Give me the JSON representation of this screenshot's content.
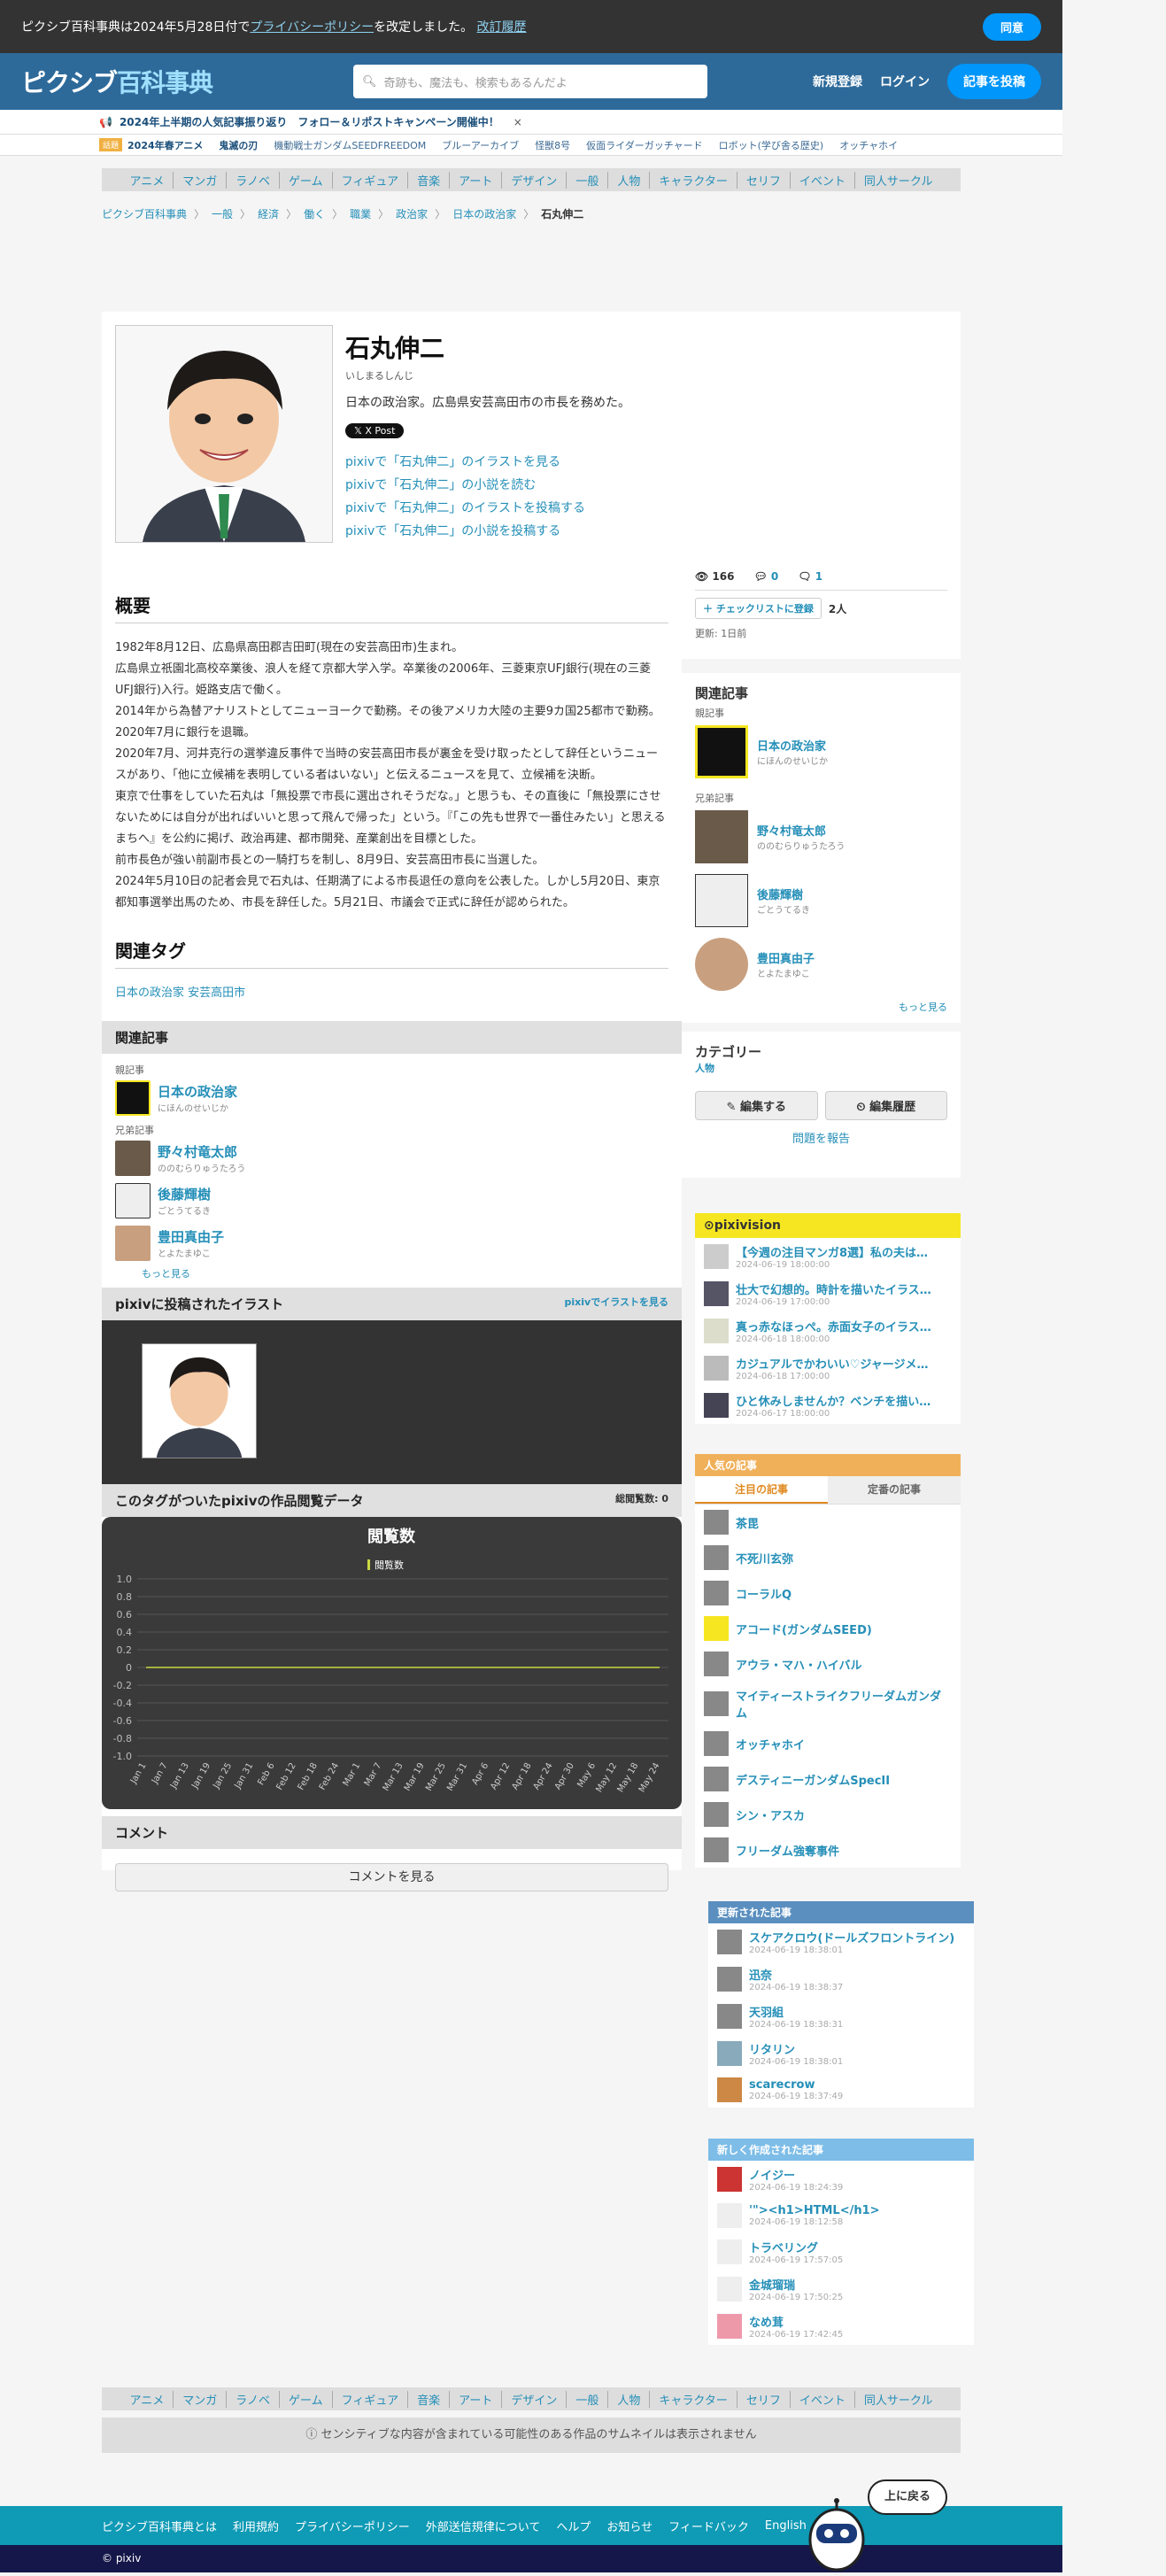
{
  "privacy": {
    "text": "ピクシブ百科事典は2024年5月28日付で",
    "link": "プライバシーポリシー",
    "text2": "を改定しました。",
    "history": "改訂履歴",
    "agree": "同意"
  },
  "header": {
    "logo_a": "ピクシブ",
    "logo_b": "百科事典",
    "search_placeholder": "奇跡も、魔法も、検索もあるんだよ",
    "register": "新規登録",
    "login": "ログイン",
    "post": "記事を投稿"
  },
  "announce": {
    "text": "2024年上半期の人気記事振り返り　フォロー＆リポストキャンペーン開催中！",
    "close": "×"
  },
  "trending": {
    "tag": "話題",
    "items": [
      "2024年春アニメ",
      "鬼滅の刃",
      "機動戦士ガンダムSEEDFREEDOM",
      "ブルーアーカイブ",
      "怪獣8号",
      "仮面ライダーガッチャード",
      "ロボット(学び舎る歴史)",
      "オッチャホイ"
    ]
  },
  "categories": [
    "アニメ",
    "マンガ",
    "ラノベ",
    "ゲーム",
    "フィギュア",
    "音楽",
    "アート",
    "デザイン",
    "一般",
    "人物",
    "キャラクター",
    "セリフ",
    "イベント",
    "同人サークル"
  ],
  "breadcrumb": [
    "ピクシブ百科事典",
    "一般",
    "経済",
    "働く",
    "職業",
    "政治家",
    "日本の政治家"
  ],
  "breadcrumb_current": "石丸伸二",
  "article": {
    "title": "石丸伸二",
    "reading": "いしまるしんじ",
    "desc": "日本の政治家。広島県安芸高田市の市長を務めた。",
    "xpost": "X Post",
    "links": [
      "pixivで「石丸伸二」のイラストを見る",
      "pixivで「石丸伸二」の小説を読む",
      "pixivで「石丸伸二」のイラストを投稿する",
      "pixivで「石丸伸二」の小説を投稿する"
    ]
  },
  "overview": {
    "heading": "概要",
    "paragraphs": [
      "1982年8月12日、広島県高田郡吉田町(現在の安芸高田市)生まれ。",
      "広島県立祇園北高校卒業後、浪人を経て京都大学入学。卒業後の2006年、三菱東京UFJ銀行(現在の三菱UFJ銀行)入行。姫路支店で働く。",
      "2014年から為替アナリストとしてニューヨークで勤務。その後アメリカ大陸の主要9カ国25都市で勤務。2020年7月に銀行を退職。",
      "2020年7月、河井克行の選挙違反事件で当時の安芸高田市長が裏金を受け取ったとして辞任というニュースがあり、「他に立候補を表明している者はいない」と伝えるニュースを見て、立候補を決断。",
      "東京で仕事をしていた石丸は「無投票で市長に選出されそうだな。」と思うも、その直後に「無投票にさせないためには自分が出ればいいと思って飛んで帰った」という。『「この先も世界で一番住みたい」と思えるまちへ』を公約に掲げ、政治再建、都市開発、産業創出を目標とした。",
      "前市長色が強い前副市長との一騎打ちを制し、8月9日、安芸高田市長に当選した。",
      "2024年5月10日の記者会見で石丸は、任期満了による市長退任の意向を公表した。しかし5月20日、東京都知事選挙出馬のため、市長を辞任した。5月21日、市議会で正式に辞任が認められた。"
    ]
  },
  "related_tags": {
    "heading": "関連タグ",
    "tags": [
      "日本の政治家",
      "安芸高田市"
    ]
  },
  "related_articles": {
    "heading": "関連記事",
    "parent_label": "親記事",
    "parent": {
      "name": "日本の政治家",
      "reading": "にほんのせいじか"
    },
    "sibling_label": "兄弟記事",
    "siblings": [
      {
        "name": "野々村竜太郎",
        "reading": "ののむらりゅうたろう"
      },
      {
        "name": "後藤輝樹",
        "reading": "ごとうてるき"
      },
      {
        "name": "豊田真由子",
        "reading": "とよたまゆこ"
      }
    ],
    "more": "もっと見る"
  },
  "illust": {
    "heading": "pixivに投稿されたイラスト",
    "link": "pixivでイラストを見る"
  },
  "views": {
    "heading": "このタグがついたpixivの作品閲覧データ",
    "total": "総閲覧数: 0",
    "chart_title": "閲覧数"
  },
  "chart_data": {
    "type": "line",
    "title": "閲覧数",
    "series": [
      {
        "name": "閲覧数",
        "values": [
          0,
          0,
          0,
          0,
          0,
          0,
          0,
          0,
          0,
          0,
          0,
          0,
          0,
          0,
          0,
          0,
          0,
          0,
          0,
          0,
          0,
          0,
          0,
          0,
          0
        ]
      }
    ],
    "x": [
      "Jan 1",
      "Jan 7",
      "Jan 13",
      "Jan 19",
      "Jan 25",
      "Jan 31",
      "Feb 6",
      "Feb 12",
      "Feb 18",
      "Feb 24",
      "Mar 1",
      "Mar 7",
      "Mar 13",
      "Mar 19",
      "Mar 25",
      "Mar 31",
      "Apr 6",
      "Apr 12",
      "Apr 18",
      "Apr 24",
      "Apr 30",
      "May 6",
      "May 12",
      "May 18",
      "May 24"
    ],
    "yticks": [
      "1.0",
      "0.8",
      "0.6",
      "0.4",
      "0.2",
      "0",
      "-0.2",
      "-0.4",
      "-0.6",
      "-0.8",
      "-1.0"
    ],
    "ylim": [
      -1.0,
      1.0
    ],
    "legend": "top"
  },
  "comments": {
    "heading": "コメント",
    "button": "コメントを見る"
  },
  "stats": {
    "views": "166",
    "comments": "0",
    "pixiv": "1",
    "checklist": "チェックリストに登録",
    "people": "2人",
    "updated": "更新: 1日前"
  },
  "side_related": {
    "heading": "関連記事",
    "parent_label": "親記事",
    "sibling_label": "兄弟記事",
    "more": "もっと見る"
  },
  "category": {
    "heading": "カテゴリー",
    "value": "人物"
  },
  "actions": {
    "edit": "編集する",
    "history": "編集履歴",
    "report": "問題を報告"
  },
  "pixivision": {
    "heading": "pixivision",
    "items": [
      {
        "title": "【今週の注目マンガ8選】私の夫は…",
        "date": "2024-06-19 18:00:00"
      },
      {
        "title": "壮大で幻想的。時計を描いたイラス…",
        "date": "2024-06-19 17:00:00"
      },
      {
        "title": "真っ赤なほっぺ。赤面女子のイラス…",
        "date": "2024-06-18 18:00:00"
      },
      {
        "title": "カジュアルでかわいい♡ジャージメ…",
        "date": "2024-06-18 17:00:00"
      },
      {
        "title": "ひと休みしませんか？ベンチを描い…",
        "date": "2024-06-17 18:00:00"
      }
    ]
  },
  "popular": {
    "heading": "人気の記事",
    "tab1": "注目の記事",
    "tab2": "定番の記事",
    "items": [
      "茶毘",
      "不死川玄弥",
      "コーラルQ",
      "アコード(ガンダムSEED)",
      "アウラ・マハ・ハイバル",
      "マイティーストライクフリーダムガンダム",
      "オッチャホイ",
      "デスティニーガンダムSpecII",
      "シン・アスカ",
      "フリーダム強奪事件"
    ]
  },
  "updated": {
    "heading": "更新された記事",
    "items": [
      {
        "title": "スケアクロウ(ドールズフロントライン)",
        "date": "2024-06-19 18:38:01"
      },
      {
        "title": "迅奈",
        "date": "2024-06-19 18:38:37"
      },
      {
        "title": "天羽組",
        "date": "2024-06-19 18:38:31"
      },
      {
        "title": "リタリン",
        "date": "2024-06-19 18:38:01"
      },
      {
        "title": "scarecrow",
        "date": "2024-06-19 18:37:49"
      }
    ]
  },
  "newart": {
    "heading": "新しく作成された記事",
    "items": [
      {
        "title": "ノイジー",
        "date": "2024-06-19 18:24:39"
      },
      {
        "title": "'\"><h1>HTML</h1>",
        "date": "2024-06-19 18:12:58"
      },
      {
        "title": "トラベリング",
        "date": "2024-06-19 17:57:05"
      },
      {
        "title": "金城瑠瑞",
        "date": "2024-06-19 17:50:25"
      },
      {
        "title": "なめ茸",
        "date": "2024-06-19 17:42:45"
      }
    ]
  },
  "sensitive": "センシティブな内容が含まれている可能性のある作品のサムネイルは表示されません",
  "footer": {
    "links": [
      "ピクシブ百科事典とは",
      "利用規約",
      "プライバシーポリシー",
      "外部送信規律について",
      "ヘルプ",
      "お知らせ",
      "フィードバック",
      "English"
    ],
    "copy": "© pixiv",
    "totop": "上に戻る"
  }
}
